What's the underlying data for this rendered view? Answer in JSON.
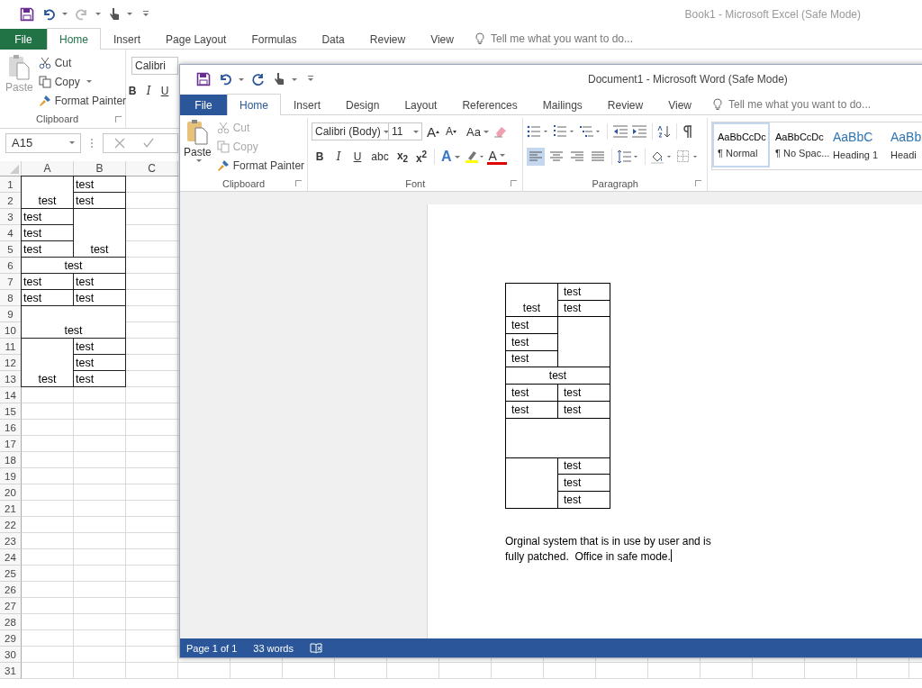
{
  "excel": {
    "title": "Book1 - Microsoft Excel (Safe Mode)",
    "tabs": [
      {
        "label": "File",
        "kind": "file",
        "selected": false
      },
      {
        "label": "Home",
        "kind": "tab",
        "selected": true
      },
      {
        "label": "Insert",
        "kind": "tab",
        "selected": false
      },
      {
        "label": "Page Layout",
        "kind": "tab",
        "selected": false
      },
      {
        "label": "Formulas",
        "kind": "tab",
        "selected": false
      },
      {
        "label": "Data",
        "kind": "tab",
        "selected": false
      },
      {
        "label": "Review",
        "kind": "tab",
        "selected": false
      },
      {
        "label": "View",
        "kind": "tab",
        "selected": false
      }
    ],
    "tell_me": {
      "placeholder": "Tell me what you want to do..."
    },
    "clipboard": {
      "paste": {
        "label": "Paste",
        "disabled": true
      },
      "items": [
        {
          "label": "Cut",
          "kind": "cut",
          "disabled": false
        },
        {
          "label": "Copy",
          "kind": "copy",
          "disabled": false,
          "dropdown": true
        },
        {
          "label": "Format Painter",
          "kind": "painter",
          "disabled": false
        }
      ],
      "group_label": "Clipboard"
    },
    "font_name": "Calibri",
    "format_buttons": [
      "B",
      "I",
      "U"
    ],
    "name_box": "A15",
    "columns": [
      "A",
      "B",
      "C"
    ],
    "rows": [
      {
        "number": "1",
        "cells": [
          {
            "text": "test",
            "rowspan": 2
          },
          {
            "text": "test"
          }
        ]
      },
      {
        "number": "2",
        "cells": [
          {
            "text": "test"
          }
        ]
      },
      {
        "number": "3",
        "cells": [
          {
            "text": "test"
          },
          {
            "text": "test",
            "rowspan": 3
          }
        ]
      },
      {
        "number": "4",
        "cells": [
          {
            "text": "test"
          }
        ]
      },
      {
        "number": "5",
        "cells": [
          {
            "text": "test"
          }
        ]
      },
      {
        "number": "6",
        "cells": [
          {
            "text": "test",
            "colspan": 2
          }
        ]
      },
      {
        "number": "7",
        "cells": [
          {
            "text": "test"
          },
          {
            "text": "test"
          }
        ]
      },
      {
        "number": "8",
        "cells": [
          {
            "text": "test"
          },
          {
            "text": "test"
          }
        ]
      },
      {
        "number": "9",
        "cells": [
          {
            "text": "test",
            "colspan": 2,
            "rowspan": 2
          }
        ]
      },
      {
        "number": "10"
      },
      {
        "number": "11",
        "cells": [
          {
            "text": "test",
            "rowspan": 3
          },
          {
            "text": "test"
          }
        ]
      },
      {
        "number": "12",
        "cells": [
          {
            "text": "test"
          }
        ]
      },
      {
        "number": "13",
        "cells": [
          {
            "text": "test"
          }
        ]
      },
      {
        "number": "14"
      },
      {
        "number": "15"
      },
      {
        "number": "16"
      },
      {
        "number": "17"
      },
      {
        "number": "18"
      },
      {
        "number": "19"
      },
      {
        "number": "20"
      },
      {
        "number": "21"
      },
      {
        "number": "22"
      },
      {
        "number": "23"
      },
      {
        "number": "24"
      },
      {
        "number": "25"
      },
      {
        "number": "26"
      },
      {
        "number": "27"
      },
      {
        "number": "28"
      },
      {
        "number": "29"
      },
      {
        "number": "30"
      },
      {
        "number": "31"
      }
    ]
  },
  "word": {
    "title": "Document1 - Microsoft Word (Safe Mode)",
    "tabs": [
      {
        "label": "File",
        "kind": "file",
        "selected": false
      },
      {
        "label": "Home",
        "kind": "tab",
        "selected": true
      },
      {
        "label": "Insert",
        "kind": "tab",
        "selected": false
      },
      {
        "label": "Design",
        "kind": "tab",
        "selected": false
      },
      {
        "label": "Layout",
        "kind": "tab",
        "selected": false
      },
      {
        "label": "References",
        "kind": "tab",
        "selected": false
      },
      {
        "label": "Mailings",
        "kind": "tab",
        "selected": false
      },
      {
        "label": "Review",
        "kind": "tab",
        "selected": false
      },
      {
        "label": "View",
        "kind": "tab",
        "selected": false
      }
    ],
    "tell_me": {
      "placeholder": "Tell me what you want to do..."
    },
    "clipboard": {
      "paste": {
        "label": "Paste",
        "disabled": false
      },
      "items": [
        {
          "label": "Cut",
          "kind": "cut",
          "disabled": true
        },
        {
          "label": "Copy",
          "kind": "copy",
          "disabled": true
        },
        {
          "label": "Format Painter",
          "kind": "painter",
          "disabled": false
        }
      ],
      "group_label": "Clipboard"
    },
    "font": {
      "name": "Calibri (Body)",
      "size": "11",
      "grow": "A",
      "shrink": "A",
      "change_case": "Aa",
      "format_buttons": [
        "B",
        "I",
        "U",
        "abc",
        "x$_{2}$",
        "x$^{2}$"
      ],
      "effects": "A",
      "font_color": "A",
      "group_label": "Font"
    },
    "paragraph": {
      "group_label": "Paragraph",
      "alignment": [
        {
          "kind": "left",
          "selected": true
        },
        {
          "kind": "center",
          "selected": false
        },
        {
          "kind": "right",
          "selected": false
        },
        {
          "kind": "justify",
          "selected": false
        }
      ]
    },
    "styles": [
      {
        "preview": "AaBbCcDc",
        "name": "¶ Normal",
        "kind": "body",
        "selected": true
      },
      {
        "preview": "AaBbCcDc",
        "name": "¶ No Spac...",
        "kind": "body",
        "selected": false
      },
      {
        "preview": "AaBbC",
        "name": "Heading 1",
        "kind": "heading",
        "selected": false
      },
      {
        "preview": "AaBb",
        "name": "Headi",
        "kind": "heading",
        "selected": false
      }
    ],
    "table": [
      {
        "cells": [
          {
            "text": "test",
            "rowspan": 2
          },
          {
            "text": "test"
          }
        ]
      },
      {
        "cells": [
          {
            "text": "test"
          }
        ]
      },
      {
        "cells": [
          {
            "text": "test"
          },
          {
            "rowspan": 3
          }
        ]
      },
      {
        "cells": [
          {
            "text": "test"
          }
        ]
      },
      {
        "cells": [
          {
            "text": "test"
          }
        ]
      },
      {
        "cells": [
          {
            "text": "test",
            "colspan": 2
          }
        ]
      },
      {
        "cells": [
          {
            "text": "test"
          },
          {
            "text": "test"
          }
        ]
      },
      {
        "cells": [
          {
            "text": "test"
          },
          {
            "text": "test"
          }
        ]
      },
      {
        "cells": [
          {
            "colspan": 2
          }
        ]
      },
      {
        "cells": [
          {
            "rowspan": 3
          },
          {
            "text": "test"
          }
        ]
      },
      {
        "cells": [
          {
            "text": "test"
          }
        ]
      },
      {
        "cells": [
          {
            "text": "test"
          }
        ]
      }
    ],
    "paragraph_text": "Orginal system that is in use by user and is fully patched.  Office in safe mode.",
    "status": {
      "page": "Page 1 of 1",
      "words": "33 words"
    }
  }
}
